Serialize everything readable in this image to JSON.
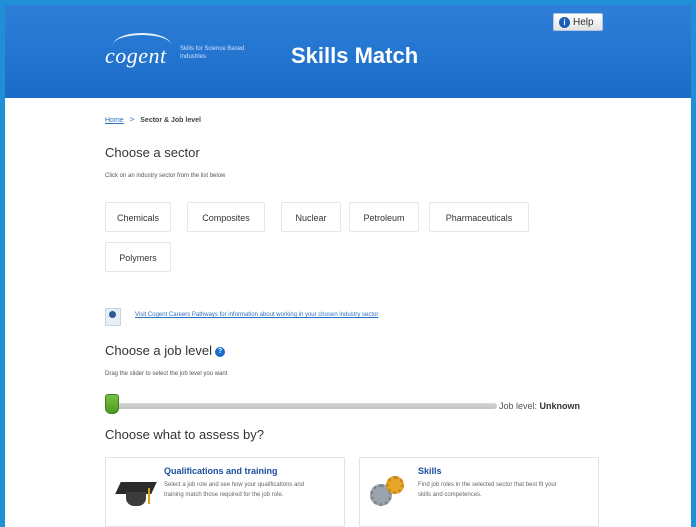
{
  "header": {
    "logo_word": "cogent",
    "logo_tagline": "Skills for Science Based Industries",
    "title": "Skills Match",
    "help_label": "Help",
    "help_icon": "info-icon"
  },
  "breadcrumb": {
    "home": "Home",
    "separator": ">",
    "current": "Sector & Job level"
  },
  "sector": {
    "heading": "Choose a sector",
    "instruction": "Click on an industry sector from the list below",
    "options": [
      "Chemicals",
      "Composites",
      "Nuclear",
      "Petroleum",
      "Pharmaceuticals",
      "Polymers"
    ]
  },
  "info": {
    "icon": "globe-icon",
    "link": "Visit Cogent Careers Pathways for information about working in your chosen industry sector"
  },
  "job_level": {
    "heading": "Choose a job level",
    "help_glyph": "?",
    "instruction": "Drag the slider to select the job level you want",
    "label": "Job level:",
    "value": "Unknown"
  },
  "assess": {
    "heading": "Choose what to assess by?",
    "cards": [
      {
        "title": "Qualifications and training",
        "desc": "Select a job role and see how your qualifications and training match those required for the job role.",
        "icon": "graduation-cap-icon"
      },
      {
        "title": "Skills",
        "desc": "Find job roles in the selected sector that best fit your skills and competences.",
        "icon": "gears-icon"
      }
    ]
  },
  "colors": {
    "header_blue": "#1a6cc8",
    "link_blue": "#2b6fc0",
    "slider_green": "#5aa82a"
  }
}
